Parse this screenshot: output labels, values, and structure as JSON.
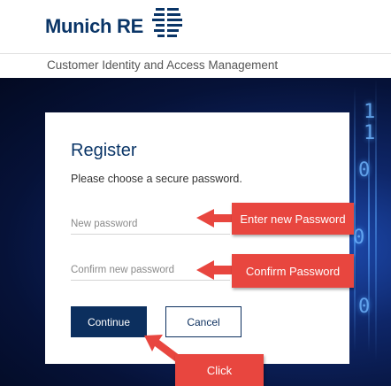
{
  "header": {
    "brand_text": "Munich RE",
    "subtitle": "Customer Identity and Access Management"
  },
  "form": {
    "title": "Register",
    "description": "Please choose a secure password.",
    "new_password_placeholder": "New password",
    "confirm_password_placeholder": "Confirm new password",
    "continue_label": "Continue",
    "cancel_label": "Cancel"
  },
  "callouts": {
    "enter_password": "Enter new Password",
    "confirm_password": "Confirm Password",
    "click": "Click"
  },
  "background": {
    "binary_digits": [
      "1",
      "1",
      "0",
      "0",
      "0"
    ]
  },
  "colors": {
    "brand_navy": "#0a3567",
    "button_navy": "#0c2f5e",
    "callout_red": "#e8463f"
  }
}
